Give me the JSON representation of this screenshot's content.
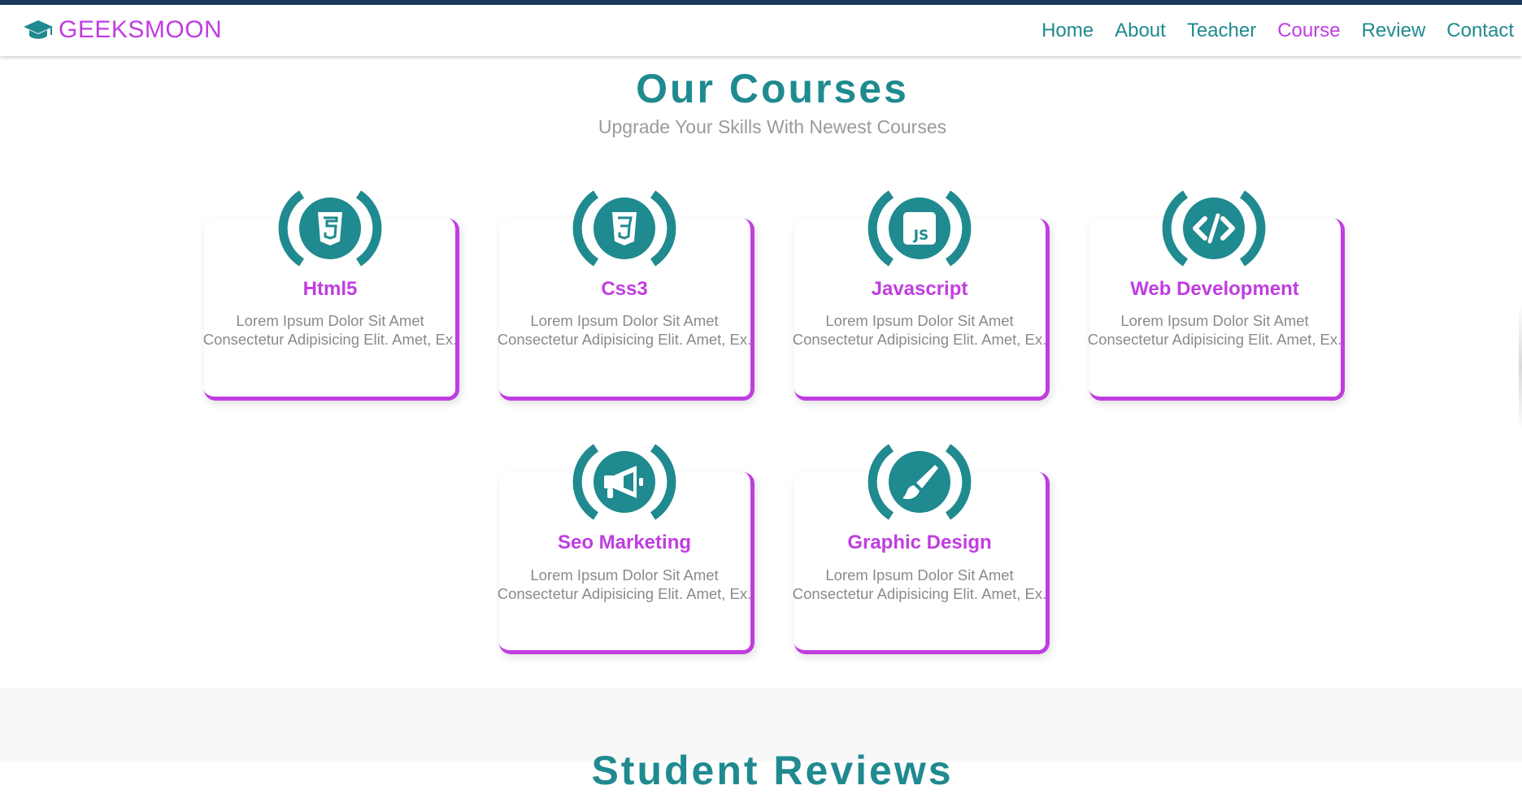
{
  "navbar": {
    "brand": "GEEKSMOON",
    "brand_icon": "graduation-cap-icon",
    "links": [
      "Home",
      "About",
      "Teacher",
      "Course",
      "Review",
      "Contact"
    ],
    "active_link": "Course"
  },
  "courses_section": {
    "title": "Our Courses",
    "subtitle": "Upgrade Your Skills With Newest Courses",
    "cards": [
      {
        "title": "Html5",
        "icon": "html5-icon",
        "text": "Lorem Ipsum Dolor Sit Amet Consectetur Adipisicing Elit. Amet, Ex."
      },
      {
        "title": "Css3",
        "icon": "css3-icon",
        "text": "Lorem Ipsum Dolor Sit Amet Consectetur Adipisicing Elit. Amet, Ex."
      },
      {
        "title": "Javascript",
        "icon": "javascript-icon",
        "text": "Lorem Ipsum Dolor Sit Amet Consectetur Adipisicing Elit. Amet, Ex."
      },
      {
        "title": "Web Development",
        "icon": "code-icon",
        "text": "Lorem Ipsum Dolor Sit Amet Consectetur Adipisicing Elit. Amet, Ex."
      },
      {
        "title": "Seo Marketing",
        "icon": "megaphone-icon",
        "text": "Lorem Ipsum Dolor Sit Amet Consectetur Adipisicing Elit. Amet, Ex."
      },
      {
        "title": "Graphic Design",
        "icon": "paintbrush-icon",
        "text": "Lorem Ipsum Dolor Sit Amet Consectetur Adipisicing Elit. Amet, Ex."
      }
    ]
  },
  "next_section": {
    "title": "Student Reviews"
  },
  "colors": {
    "accent": "#c03de0",
    "teal": "#1f8a8f",
    "topbar": "#1b3a5c",
    "muted_text": "#8a8a8a"
  }
}
